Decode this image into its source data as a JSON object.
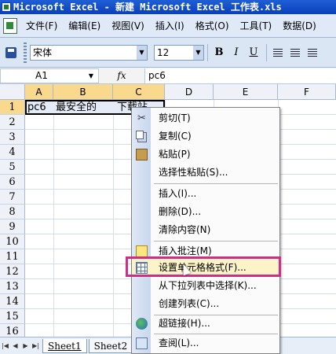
{
  "window": {
    "title": "Microsoft Excel - 新建 Microsoft Excel 工作表.xls"
  },
  "menu": {
    "items": [
      "文件(F)",
      "编辑(E)",
      "视图(V)",
      "插入(I)",
      "格式(O)",
      "工具(T)",
      "数据(D)"
    ]
  },
  "toolbar": {
    "font_name": "宋体",
    "font_size": "12",
    "bold": "B",
    "italic": "I",
    "underline": "U"
  },
  "formula_bar": {
    "name_box": "A1",
    "fx": "fx",
    "content": "pc6"
  },
  "grid": {
    "columns": [
      "A",
      "B",
      "C",
      "D",
      "E",
      "F"
    ],
    "rows": [
      "1",
      "2",
      "3",
      "4",
      "5",
      "6",
      "7",
      "8",
      "9",
      "10",
      "11",
      "12",
      "13",
      "14",
      "15",
      "16"
    ],
    "cells": {
      "A1": "pc6",
      "B1": "最安全的",
      "C1": "下载站"
    }
  },
  "sheet_tabs": [
    "Sheet1",
    "Sheet2"
  ],
  "context_menu": {
    "items": [
      {
        "label": "剪切(T)",
        "icon": "cut-icon"
      },
      {
        "label": "复制(C)",
        "icon": "copy-icon"
      },
      {
        "label": "粘贴(P)",
        "icon": "paste-icon"
      },
      {
        "label": "选择性粘贴(S)...",
        "icon": ""
      },
      {
        "label": "插入(I)...",
        "icon": ""
      },
      {
        "label": "删除(D)...",
        "icon": ""
      },
      {
        "label": "清除内容(N)",
        "icon": ""
      },
      {
        "label": "插入批注(M)",
        "icon": "comment-icon"
      },
      {
        "label": "设置单元格格式(F)...",
        "icon": "format-cells-icon"
      },
      {
        "label": "从下拉列表中选择(K)...",
        "icon": ""
      },
      {
        "label": "创建列表(C)...",
        "icon": ""
      },
      {
        "label": "超链接(H)...",
        "icon": "hyperlink-icon"
      },
      {
        "label": "查阅(L)...",
        "icon": "lookup-icon"
      }
    ]
  },
  "colors": {
    "highlight_border": "#cc2f8a",
    "title_bar": "#1f5fd6",
    "selected_header": "#f9d98e"
  }
}
